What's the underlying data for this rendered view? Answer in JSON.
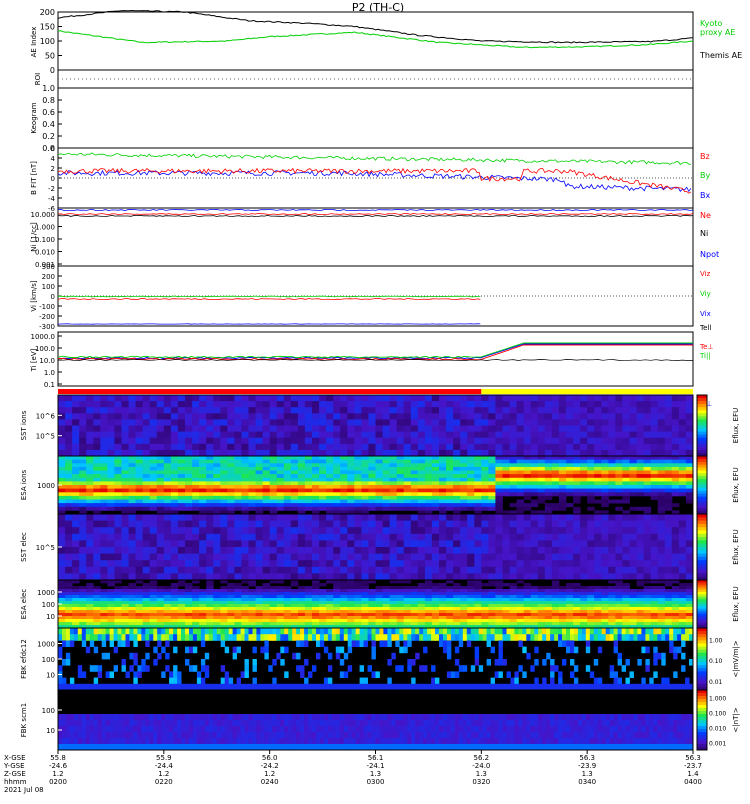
{
  "title": "P2 (TH-C)",
  "chart_data": [
    {
      "type": "line",
      "panel": "ae",
      "ylabel": "AE Index",
      "ylim": [
        0,
        200
      ],
      "yticks": [
        "0",
        "50",
        "100",
        "150",
        "200"
      ],
      "series": [
        {
          "name": "Kyoto proxy AE",
          "color": "#00d000",
          "x": [
            0,
            8,
            16,
            20,
            28,
            36,
            44,
            50,
            56,
            60
          ],
          "values": [
            135,
            95,
            100,
            115,
            130,
            95,
            78,
            80,
            88,
            100
          ]
        },
        {
          "name": "Themis AE",
          "color": "#000000",
          "x": [
            0,
            6,
            12,
            18,
            24,
            28,
            34,
            40,
            48,
            56,
            60
          ],
          "values": [
            180,
            205,
            200,
            170,
            160,
            150,
            120,
            100,
            95,
            98,
            110
          ]
        }
      ]
    },
    {
      "type": "line",
      "panel": "roi",
      "ylabel": "ROI",
      "yticks": []
    },
    {
      "type": "line",
      "panel": "keogram",
      "ylabel": "Keogram",
      "ylim": [
        0,
        1
      ],
      "yticks": [
        "0.0",
        "0.2",
        "0.4",
        "0.6",
        "0.8",
        "1.0"
      ]
    },
    {
      "type": "line",
      "panel": "bfield",
      "ylabel": "B FIT [nT]",
      "ylim": [
        -6,
        6
      ],
      "yticks": [
        "-6",
        "-4",
        "-2",
        "0",
        "2",
        "4",
        "6"
      ],
      "series": [
        {
          "name": "Bz",
          "color": "#ff0000"
        },
        {
          "name": "By",
          "color": "#00d000"
        },
        {
          "name": "Bx",
          "color": "#0000ff"
        }
      ]
    },
    {
      "type": "line",
      "panel": "density",
      "ylabel": "Ni [1/cc]",
      "yticks": [
        "10.000",
        "1.000",
        "0.100",
        "0.010",
        "0.001"
      ],
      "series": [
        {
          "name": "Ne",
          "color": "#ff0000"
        },
        {
          "name": "Ni",
          "color": "#000000"
        },
        {
          "name": "Npot",
          "color": "#0000ff"
        }
      ]
    },
    {
      "type": "line",
      "panel": "velocity",
      "ylabel": "Vi [km/s]",
      "ylim": [
        -300,
        300
      ],
      "yticks": [
        "300",
        "200",
        "100",
        "0",
        "-100",
        "-200",
        "-300"
      ],
      "series": [
        {
          "name": "Viz",
          "color": "#ff0000"
        },
        {
          "name": "Viy",
          "color": "#00d000"
        },
        {
          "name": "Vix",
          "color": "#0000ff"
        }
      ]
    },
    {
      "type": "line",
      "panel": "temperature",
      "ylabel": "Ti [eV]",
      "yticks": [
        "1000.0",
        "100.0",
        "10.0",
        "1.0",
        "0.1"
      ],
      "series": [
        {
          "name": "Te⊥",
          "color": "#ff0000"
        },
        {
          "name": "Ti||",
          "color": "#00d000"
        },
        {
          "name": "Ti⊥",
          "color": "#0000ff"
        }
      ]
    },
    {
      "type": "heatmap",
      "panel": "spectrograms",
      "panels": [
        {
          "ylabel": "SST [eV]",
          "yticks": [
            "10^6",
            "10^5"
          ],
          "colorbar_label": "Eflux, EFU"
        },
        {
          "ylabel": "ESA [eV]",
          "yticks": [
            "1000"
          ],
          "colorbar_label": "Eflux, EFU"
        },
        {
          "ylabel": "SST [eV]",
          "yticks": [
            "10^5"
          ],
          "colorbar_label": "Eflux, EFU"
        },
        {
          "ylabel": "ESA [eV]",
          "yticks": [
            "1000",
            "100",
            "10"
          ],
          "colorbar_label": "Eflux, EFU"
        },
        {
          "ylabel": "FBK [Hz]",
          "yticks": [
            "1000",
            "100",
            "10"
          ],
          "colorbar_label": "<|mV/m|>",
          "cticks": [
            "1.00",
            "0.10",
            "0.01"
          ]
        },
        {
          "ylabel": "FBK [Hz]",
          "yticks": [
            "100",
            "10"
          ],
          "colorbar_label": "<|nT|>",
          "cticks": [
            "1.000",
            "0.100",
            "0.010",
            "0.001"
          ]
        }
      ]
    }
  ],
  "labels": {
    "roi": "ROI",
    "keogram": "Keogram",
    "esa_i": "ESA ions",
    "esa_e": "ESA elec",
    "sst_i": "SST ions",
    "sst_e": "SST elec",
    "fbk1": "FBK efdc12",
    "fbk2": "FBK scm1",
    "ae_axis": "AE Index",
    "b_axis": "B FIT [nT]",
    "ni_axis": "Ni [1/cc]",
    "vi_axis": "Vi [km/s]",
    "ti_axis": "Ti [eV]"
  },
  "xaxis": {
    "row_labels": [
      "X-GSE",
      "Y-GSE",
      "Z-GSE",
      "hhmm",
      "2021 Jul 08"
    ],
    "ticks": [
      {
        "x": "55.8",
        "y": "-24.6",
        "z": "1.2",
        "t": "0200"
      },
      {
        "x": "55.9",
        "y": "-24.4",
        "z": "1.2",
        "t": "0220"
      },
      {
        "x": "56.0",
        "y": "-24.2",
        "z": "1.2",
        "t": "0240"
      },
      {
        "x": "56.1",
        "y": "-24.1",
        "z": "1.3",
        "t": "0300"
      },
      {
        "x": "56.2",
        "y": "-24.0",
        "z": "1.3",
        "t": "0320"
      },
      {
        "x": "56.3",
        "y": "-23.9",
        "z": "1.3",
        "t": "0340"
      },
      {
        "x": "56.3",
        "y": "-23.7",
        "z": "1.4",
        "t": "0400"
      }
    ]
  },
  "colorbar_labels": [
    "Eflux, EFU",
    "Eflux, EFU",
    "Eflux, EFU",
    "Eflux, EFU",
    "<|mV/m|>",
    "<|nT|>"
  ],
  "colors": {
    "red": "#ff0000",
    "green": "#00d000",
    "blue": "#0000ff",
    "yellow": "#ffff00"
  }
}
